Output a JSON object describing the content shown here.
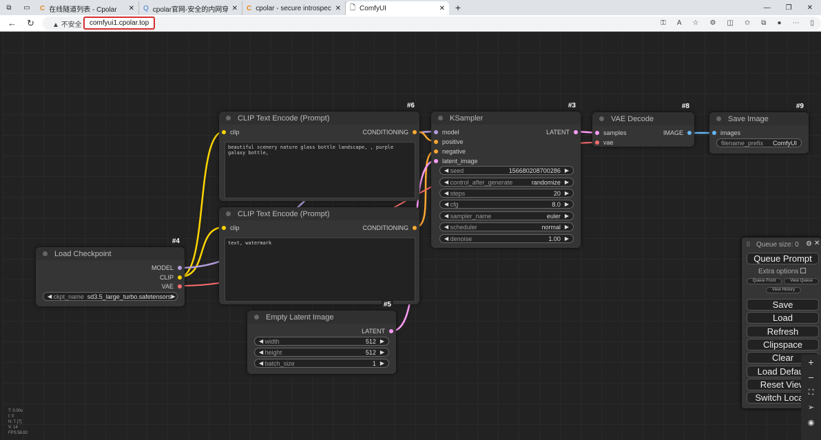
{
  "browser": {
    "tabs": [
      {
        "title": "在线隧道列表 - Cpolar",
        "icon": "cpolar-icon"
      },
      {
        "title": "cpolar官网-安全的内网穿透工具 |",
        "icon": "search-icon"
      },
      {
        "title": "cpolar - secure introspectable tun",
        "icon": "cpolar-icon"
      },
      {
        "title": "ComfyUI",
        "icon": "page-icon",
        "active": true
      }
    ],
    "security": "不安全",
    "url": "comfyui1.cpolar.top"
  },
  "nodes": {
    "clip6": {
      "title": "CLIP Text Encode (Prompt)",
      "id": "#6",
      "input": "clip",
      "output": "CONDITIONING",
      "text": "beautiful scenery nature glass bottle landscape, , purple galaxy bottle,"
    },
    "clip7": {
      "title": "CLIP Text Encode (Prompt)",
      "input": "clip",
      "output": "CONDITIONING",
      "text": "text, watermark"
    },
    "ksampler": {
      "title": "KSampler",
      "id": "#3",
      "inputs": [
        "model",
        "positive",
        "negative",
        "latent_image"
      ],
      "output": "LATENT",
      "widgets": [
        {
          "name": "seed",
          "value": "156680208700286"
        },
        {
          "name": "control_after_generate",
          "value": "randomize"
        },
        {
          "name": "steps",
          "value": "20"
        },
        {
          "name": "cfg",
          "value": "8.0"
        },
        {
          "name": "sampler_name",
          "value": "euler"
        },
        {
          "name": "scheduler",
          "value": "normal"
        },
        {
          "name": "denoise",
          "value": "1.00"
        }
      ]
    },
    "vae": {
      "title": "VAE Decode",
      "id": "#8",
      "inputs": [
        "samples",
        "vae"
      ],
      "output": "IMAGE"
    },
    "save": {
      "title": "Save Image",
      "id": "#9",
      "input": "images",
      "widget": {
        "name": "filename_prefix",
        "value": "ComfyUI"
      }
    },
    "ckpt": {
      "title": "Load Checkpoint",
      "id": "#4",
      "outputs": [
        "MODEL",
        "CLIP",
        "VAE"
      ],
      "widget": {
        "name": "ckpt_name",
        "value": "sd3.5_large_turbo.safetensors"
      }
    },
    "latent": {
      "title": "Empty Latent Image",
      "id": "#5",
      "output": "LATENT",
      "widgets": [
        {
          "name": "width",
          "value": "512"
        },
        {
          "name": "height",
          "value": "512"
        },
        {
          "name": "batch_size",
          "value": "1"
        }
      ]
    }
  },
  "panel": {
    "queue_size": "Queue size: 0",
    "queue_prompt": "Queue Prompt",
    "extra_options": "Extra options",
    "queue_front": "Queue Front",
    "view_queue": "View Queue",
    "view_history": "View History",
    "buttons": [
      "Save",
      "Load",
      "Refresh",
      "Clipspace",
      "Clear",
      "Load Default",
      "Reset View",
      "Switch Locale"
    ]
  },
  "stats": [
    "T: 0.00s",
    "I: 0",
    "N: 7 [7]",
    "V: 14",
    "FPS:58.82"
  ],
  "colors": {
    "clip": "#ffd500",
    "conditioning": "#ffa931",
    "model": "#b39ddb",
    "latent": "#ff9cf9",
    "vae": "#ff6e6e",
    "image": "#64b5f6"
  }
}
